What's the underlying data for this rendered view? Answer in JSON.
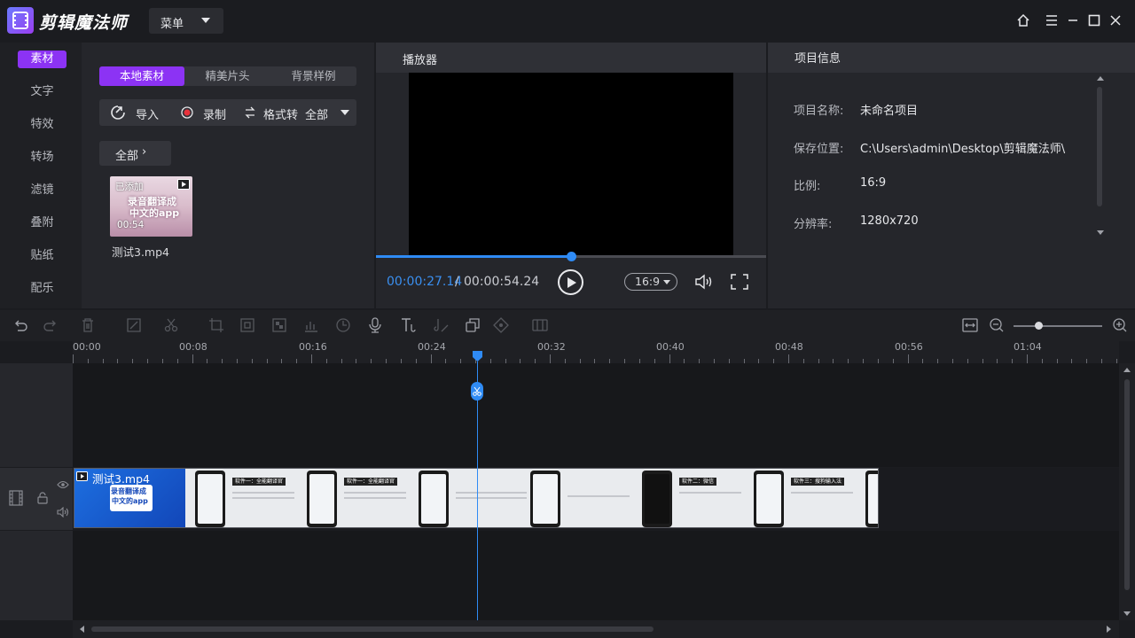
{
  "app": {
    "name": "剪辑魔法师",
    "menu_label": "菜单"
  },
  "left_nav": {
    "items": [
      "素材",
      "文字",
      "特效",
      "转场",
      "滤镜",
      "叠附",
      "贴纸",
      "配乐"
    ],
    "active": 0
  },
  "media": {
    "tabs": [
      "本地素材",
      "精美片头",
      "背景样例"
    ],
    "import_label": "导入",
    "record_label": "录制",
    "format_label": "格式转",
    "filter_value": "全部",
    "all_button": "全部",
    "item": {
      "name": "测试3.mp4",
      "added_badge": "已添加",
      "duration": "00:54",
      "thumb_text_1": "录音翻译成",
      "thumb_text_2": "中文的app"
    }
  },
  "player": {
    "title": "播放器",
    "time_current": "00:00:27.14",
    "time_separator": "/",
    "time_total": "00:00:54.24",
    "progress": 0.5,
    "ratio": "16:9"
  },
  "project_info": {
    "title": "项目信息",
    "fields": [
      {
        "key": "项目名称:",
        "value": "未命名项目"
      },
      {
        "key": "保存位置:",
        "value": "C:\\Users\\admin\\Desktop\\剪辑魔法师\\"
      },
      {
        "key": "比例:",
        "value": "16:9"
      },
      {
        "key": "分辨率:",
        "value": "1280x720"
      }
    ]
  },
  "timeline": {
    "ruler_labels": [
      "00:00",
      "00:08",
      "00:16",
      "00:24",
      "00:32",
      "00:40",
      "00:48",
      "00:56",
      "01:04"
    ],
    "zoom_level": 0.28,
    "clip": {
      "name": "测试3.mp4",
      "cover_text_1": "录音翻译成",
      "cover_text_2": "中文的app",
      "tags": [
        "软件一：全能翻译官",
        "软件一：全能翻译官",
        "软件二：微信",
        "软件三：搜狗输入法"
      ]
    }
  },
  "colors": {
    "accent": "#8c33f4",
    "playhead": "#2f8bf5",
    "record": "#e8323c"
  }
}
